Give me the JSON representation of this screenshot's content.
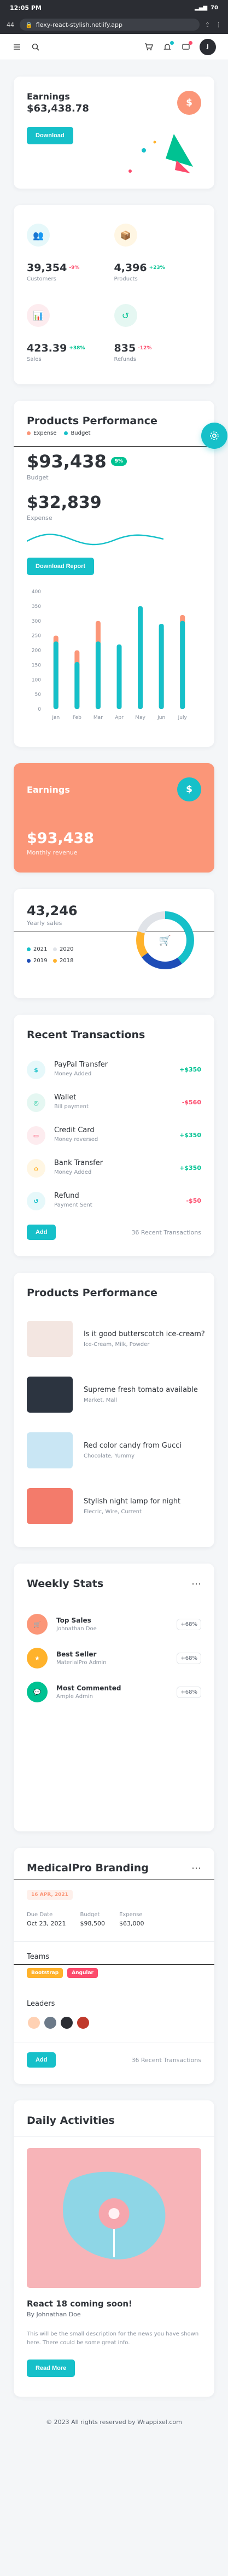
{
  "status_bar": {
    "time": "12:05 PM",
    "battery": "70"
  },
  "browser": {
    "tab_count": "44",
    "url": "flexy-react-stylish.netlify.app"
  },
  "earnings_card": {
    "title": "Earnings",
    "amount": "$63,438.78",
    "button": "Download",
    "icon_color": "#fb9678"
  },
  "stats": [
    {
      "value": "39,354",
      "change": "-9%",
      "label": "Customers",
      "color": "#16c0c9",
      "bg": "#e6f8fa",
      "change_color": "#fc4b6c"
    },
    {
      "value": "4,396",
      "change": "+23%",
      "label": "Products",
      "color": "#ffb22b",
      "bg": "#fff6e3",
      "change_color": "#00c292"
    },
    {
      "value": "423.39",
      "change": "+38%",
      "label": "Sales",
      "color": "#fc4b6c",
      "bg": "#fdecef",
      "change_color": "#00c292"
    },
    {
      "value": "835",
      "change": "-12%",
      "label": "Refunds",
      "color": "#00c292",
      "bg": "#e5f7f2",
      "change_color": "#fc4b6c"
    }
  ],
  "products_performance": {
    "title": "Products Performance",
    "legend": [
      "Expense",
      "Budget"
    ],
    "budget_value": "$93,438",
    "budget_badge": "9%",
    "budget_label": "Budget",
    "expense_value": "$32,839",
    "expense_label": "Expense",
    "button": "Download Report"
  },
  "chart_data": {
    "type": "bar",
    "categories": [
      "Jan",
      "Feb",
      "Mar",
      "Apr",
      "May",
      "Jun",
      "July"
    ],
    "series": [
      {
        "name": "Budget",
        "values": [
          230,
          160,
          230,
          220,
          350,
          290,
          300
        ]
      },
      {
        "name": "Expense",
        "values": [
          250,
          200,
          300,
          200,
          350,
          280,
          320
        ]
      }
    ],
    "colors": [
      "#16c0c9",
      "#fb9678"
    ],
    "ylim": [
      0,
      400
    ],
    "yticks": [
      "0",
      "50",
      "100",
      "150",
      "200",
      "250",
      "300",
      "350",
      "400"
    ]
  },
  "earnings_banner": {
    "title": "Earnings",
    "amount": "$93,438",
    "subtitle": "Monthly revenue",
    "bg": "#fb9678"
  },
  "yearly_sales": {
    "value": "43,246",
    "label": "Yearly sales",
    "legend": [
      {
        "year": "2021",
        "color": "#16c0c9"
      },
      {
        "year": "2020",
        "color": "#e0e3e8"
      },
      {
        "year": "2019",
        "color": "#1e4db7"
      },
      {
        "year": "2018",
        "color": "#ffb22b"
      }
    ]
  },
  "recent_transactions": {
    "title": "Recent Transactions",
    "items": [
      {
        "name": "PayPal Transfer",
        "sub": "Money Added",
        "amount": "+$350",
        "amount_color": "#00c292",
        "icon": "paypal-icon",
        "icon_color": "#16c0c9",
        "bg": "#e6f8fa"
      },
      {
        "name": "Wallet",
        "sub": "Bill payment",
        "amount": "-$560",
        "amount_color": "#fc4b6c",
        "icon": "wallet-icon",
        "icon_color": "#00c292",
        "bg": "#e5f7f2"
      },
      {
        "name": "Credit Card",
        "sub": "Money reversed",
        "amount": "+$350",
        "amount_color": "#00c292",
        "icon": "credit-card-icon",
        "icon_color": "#fc4b6c",
        "bg": "#fdecef"
      },
      {
        "name": "Bank Transfer",
        "sub": "Money Added",
        "amount": "+$350",
        "amount_color": "#00c292",
        "icon": "bank-icon",
        "icon_color": "#ffb22b",
        "bg": "#fff6e3"
      },
      {
        "name": "Refund",
        "sub": "Payment Sent",
        "amount": "-$50",
        "amount_color": "#fc4b6c",
        "icon": "refund-icon",
        "icon_color": "#16c0c9",
        "bg": "#e6f8fa"
      }
    ],
    "button": "Add",
    "count_label": "36 Recent Transactions"
  },
  "products_list": {
    "title": "Products Performance",
    "items": [
      {
        "name": "Is it good butterscotch ice-cream?",
        "sub": "Ice-Cream, Milk, Powder",
        "bg": "#f3e6e1"
      },
      {
        "name": "Supreme fresh tomato available",
        "sub": "Market, Mall",
        "bg": "#2c3440"
      },
      {
        "name": "Red color candy from Gucci",
        "sub": "Chocolate, Yummy",
        "bg": "#c9e6f4"
      },
      {
        "name": "Stylish night lamp for night",
        "sub": "Elecric, Wire, Current",
        "bg": "#f37b6b"
      }
    ]
  },
  "weekly_stats": {
    "title": "Weekly Stats",
    "items": [
      {
        "title": "Top Sales",
        "sub": "Johnathan Doe",
        "pill": "+68%",
        "color": "#fb9678",
        "bg": "#fef0eb"
      },
      {
        "title": "Best Seller",
        "sub": "MaterialPro Admin",
        "pill": "+68%",
        "color": "#ffb22b",
        "bg": "#fff6e3"
      },
      {
        "title": "Most Commented",
        "sub": "Ample Admin",
        "pill": "+68%",
        "color": "#00c292",
        "bg": "#e5f7f2"
      }
    ]
  },
  "branding": {
    "title": "MedicalPro Branding",
    "badge": "16 APR, 2021",
    "cols": [
      {
        "label": "Due Date",
        "value": "Oct 23, 2021"
      },
      {
        "label": "Budget",
        "value": "$98,500"
      },
      {
        "label": "Expense",
        "value": "$63,000"
      }
    ],
    "teams_title": "Teams",
    "teams": [
      {
        "name": "Bootstrap",
        "bg": "#ffb22b"
      },
      {
        "name": "Angular",
        "bg": "#fc4b6c"
      }
    ],
    "leaders_title": "Leaders",
    "button": "Add",
    "count_label": "36 Recent Transactions"
  },
  "daily_activities": {
    "title": "Daily Activities",
    "post_title": "React 18 coming soon!",
    "author": "By Johnathan Doe",
    "body": "This will be the small description for the news you have shown here. There could be some great info.",
    "button": "Read More"
  },
  "footer": {
    "text": "© 2023 All rights reserved by Wrappixel.com"
  }
}
